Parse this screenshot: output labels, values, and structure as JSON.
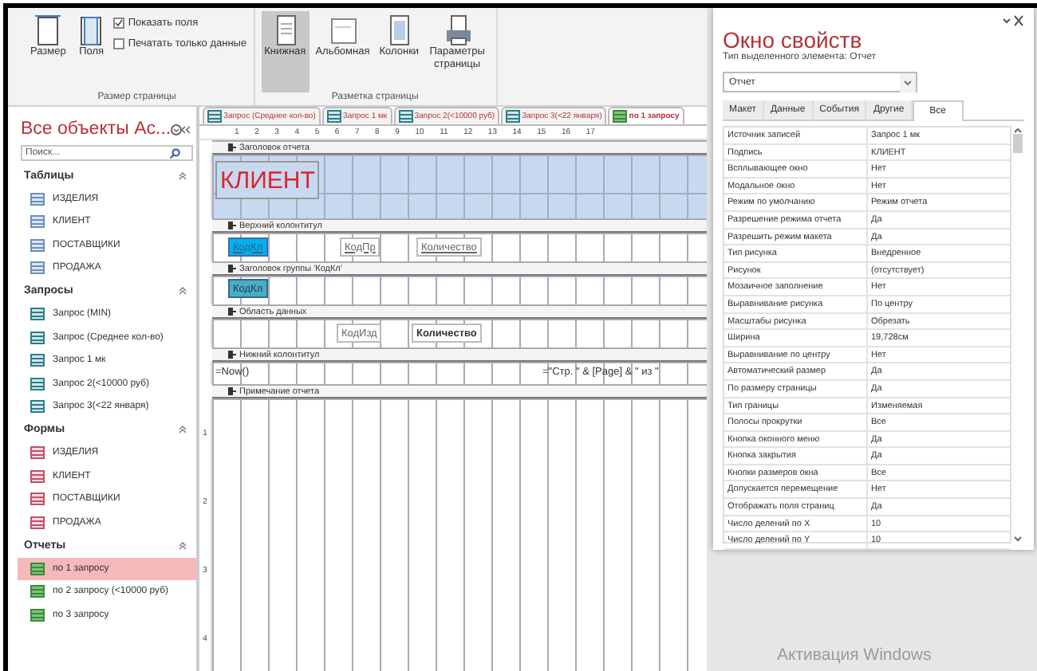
{
  "ribbon": {
    "groups": [
      {
        "label": "Размер страницы",
        "buttons": [
          {
            "kind": "size",
            "label": "Размер",
            "selected": false
          },
          {
            "kind": "margins",
            "label": "Поля",
            "selected": false
          }
        ],
        "checkboxes": [
          {
            "label": "Показать поля",
            "checked": true
          },
          {
            "label": "Печатать только данные",
            "checked": false
          }
        ]
      },
      {
        "label": "Разметка страницы",
        "buttons": [
          {
            "kind": "portrait",
            "label": "Книжная",
            "selected": true
          },
          {
            "kind": "landscape",
            "label": "Альбомная",
            "selected": false
          },
          {
            "kind": "columns",
            "label": "Колонки",
            "selected": false
          },
          {
            "kind": "setup",
            "label": "Параметры страницы",
            "selected": false
          }
        ]
      }
    ]
  },
  "navigation": {
    "title": "Все объекты Ac...",
    "search": {
      "placeholder": "Поиск..."
    },
    "groups": [
      {
        "label": "Таблицы",
        "kind": "table",
        "items": [
          {
            "label": "ИЗДЕЛИЯ",
            "selected": false
          },
          {
            "label": "КЛИЕНТ",
            "selected": false
          },
          {
            "label": "ПОСТАВЩИКИ",
            "selected": false
          },
          {
            "label": "ПРОДАЖА",
            "selected": false
          }
        ]
      },
      {
        "label": "Запросы",
        "kind": "query",
        "items": [
          {
            "label": "Запрос (MIN)",
            "selected": false
          },
          {
            "label": "Запрос (Среднее кол-во)",
            "selected": false
          },
          {
            "label": "Запрос 1 мк",
            "selected": false
          },
          {
            "label": "Запрос 2(<10000 руб)",
            "selected": false
          },
          {
            "label": "Запрос 3(<22 января)",
            "selected": false
          }
        ]
      },
      {
        "label": "Формы",
        "kind": "form",
        "items": [
          {
            "label": "ИЗДЕЛИЯ",
            "selected": false
          },
          {
            "label": "КЛИЕНТ",
            "selected": false
          },
          {
            "label": "ПОСТАВЩИКИ",
            "selected": false
          },
          {
            "label": "ПРОДАЖА",
            "selected": false
          }
        ]
      },
      {
        "label": "Отчеты",
        "kind": "report",
        "items": [
          {
            "label": "по 1 запросу",
            "selected": true
          },
          {
            "label": "по 2 запросу (<10000 руб)",
            "selected": false
          },
          {
            "label": "по 3 запросу",
            "selected": false
          }
        ]
      }
    ]
  },
  "document_tabs": [
    {
      "label": "Запрос (Среднее кол-во)",
      "kind": "query",
      "selected": false
    },
    {
      "label": "Запрос 1 мк",
      "kind": "query",
      "selected": false
    },
    {
      "label": "Запрос 2(<10000 руб)",
      "kind": "query",
      "selected": false
    },
    {
      "label": "Запрос 3(<22 января)",
      "kind": "query",
      "selected": false
    },
    {
      "label": "по 1 запросу",
      "kind": "report",
      "selected": true
    }
  ],
  "ruler_marks": [
    "1",
    "2",
    "3",
    "4",
    "5",
    "6",
    "7",
    "8",
    "9",
    "10",
    "11",
    "12",
    "13",
    "14",
    "15",
    "16",
    "17"
  ],
  "sections": [
    {
      "title": "Заголовок отчета",
      "kind": "report-header",
      "controls": [
        {
          "text": "КЛИЕНТ",
          "kind": "title"
        }
      ]
    },
    {
      "title": "Верхний колонтитул",
      "kind": "band",
      "controls": [
        {
          "text": "КодКл",
          "kind": "highlight"
        },
        {
          "text": "КодПр",
          "kind": "label"
        },
        {
          "text": "Количество",
          "kind": "label"
        }
      ]
    },
    {
      "title": "Заголовок группы 'КодКл'",
      "kind": "band",
      "controls": [
        {
          "text": "КодКл",
          "kind": "group"
        }
      ]
    },
    {
      "title": "Область данных",
      "kind": "band",
      "controls": [
        {
          "text": "КодИзд",
          "kind": "field"
        },
        {
          "text": "Количество",
          "kind": "bold"
        }
      ]
    },
    {
      "title": "Нижний колонтитул",
      "kind": "band",
      "controls": [
        {
          "text": "=Now()",
          "kind": "plain"
        },
        {
          "text": "=\"Стр. \" & [Page] & \" из \"",
          "kind": "plain"
        }
      ]
    },
    {
      "title": "Примечание отчета",
      "kind": "footer"
    }
  ],
  "vertical_ruler": [
    "1",
    "2",
    "3",
    "4"
  ],
  "property_sheet": {
    "title": "Окно свойств",
    "selection_type": "Тип выделенного элемента:  Отчет",
    "object": "Отчет",
    "tabs": [
      {
        "label": "Макет",
        "selected": false
      },
      {
        "label": "Данные",
        "selected": false
      },
      {
        "label": "События",
        "selected": false
      },
      {
        "label": "Другие",
        "selected": false
      },
      {
        "label": "Все",
        "selected": true
      }
    ],
    "rows": [
      {
        "name": "Источник записей",
        "value": "Запрос 1 мк"
      },
      {
        "name": "Подпись",
        "value": "КЛИЕНТ"
      },
      {
        "name": "Всплывающее окно",
        "value": "Нет"
      },
      {
        "name": "Модальное окно",
        "value": "Нет"
      },
      {
        "name": "Режим по умолчанию",
        "value": "Режим отчета"
      },
      {
        "name": "Разрешение режима отчета",
        "value": "Да"
      },
      {
        "name": "Разрешить режим макета",
        "value": "Да"
      },
      {
        "name": "Тип рисунка",
        "value": "Внедренное"
      },
      {
        "name": "Рисунок",
        "value": "(отсутствует)"
      },
      {
        "name": "Мозаичное заполнение",
        "value": "Нет"
      },
      {
        "name": "Выравнивание рисунка",
        "value": "По центру"
      },
      {
        "name": "Масштабы рисунка",
        "value": "Обрезать"
      },
      {
        "name": "Ширина",
        "value": "19,728см"
      },
      {
        "name": "Выравнивание по центру",
        "value": "Нет"
      },
      {
        "name": "Автоматический размер",
        "value": "Да"
      },
      {
        "name": "По размеру страницы",
        "value": "Да"
      },
      {
        "name": "Тип границы",
        "value": "Изменяемая"
      },
      {
        "name": "Полосы прокрутки",
        "value": "Все"
      },
      {
        "name": "Кнопка оконного меню",
        "value": "Да"
      },
      {
        "name": "Кнопка закрытия",
        "value": "Да"
      },
      {
        "name": "Кнопки размеров окна",
        "value": "Все"
      },
      {
        "name": "Допускается перемещение",
        "value": "Нет"
      },
      {
        "name": "Отображать поля страниц",
        "value": "Да"
      },
      {
        "name": "Число делений по X",
        "value": "10"
      },
      {
        "name": "Число делений по Y",
        "value": "10"
      }
    ]
  },
  "activation_notice": "Активация Windows"
}
